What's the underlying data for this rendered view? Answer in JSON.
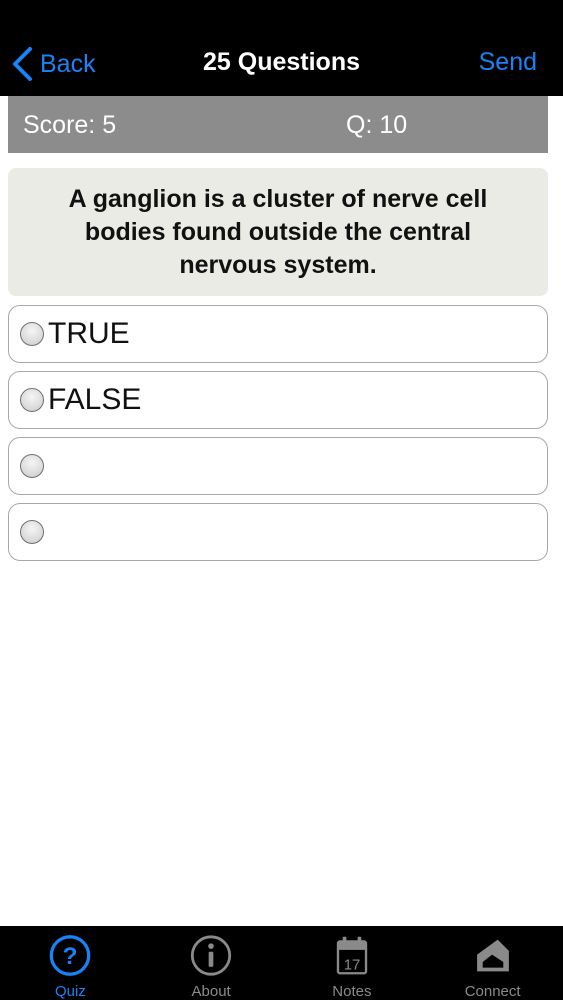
{
  "nav": {
    "back_label": "Back",
    "title": "25 Questions",
    "send_label": "Send"
  },
  "score_bar": {
    "score": "Score: 5",
    "question": "Q: 10"
  },
  "question": {
    "text": "A ganglion is a cluster of nerve cell bodies found outside the central nervous system."
  },
  "options": [
    {
      "label": "TRUE",
      "selected": false
    },
    {
      "label": "FALSE",
      "selected": false
    },
    {
      "label": "",
      "selected": false
    },
    {
      "label": "",
      "selected": false
    }
  ],
  "tabs": [
    {
      "label": "Quiz",
      "icon": "question-circle-icon",
      "active": true
    },
    {
      "label": "About",
      "icon": "info-circle-icon",
      "active": false
    },
    {
      "label": "Notes",
      "icon": "calendar-icon",
      "icon_text": "17",
      "active": false
    },
    {
      "label": "Connect",
      "icon": "connect-icon",
      "active": false
    }
  ],
  "colors": {
    "accent": "#1a82f7",
    "score_bar": "#8c8c8c",
    "question_bg": "#ebebe6",
    "tab_inactive": "#8a8a8a"
  }
}
